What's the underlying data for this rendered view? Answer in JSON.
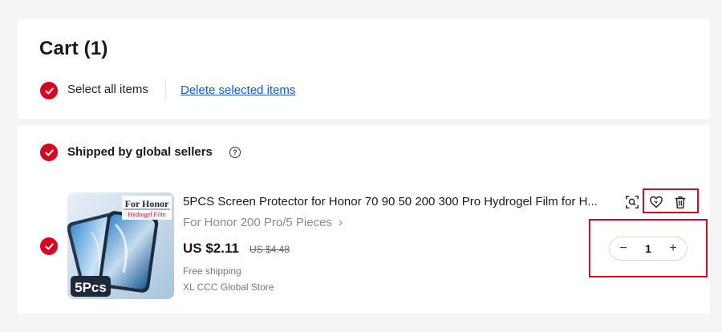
{
  "header": {
    "title": "Cart (1)",
    "select_all_label": "Select all items",
    "delete_label": "Delete selected items"
  },
  "seller_group": {
    "label": "Shipped by global sellers",
    "help_icon": "?"
  },
  "item": {
    "title": "5PCS Screen Protector for Honor 70 90 50 200 300 Pro Hydrogel Film for H...",
    "variant": "For Honor 200 Pro/5 Pieces",
    "variant_chevron": "›",
    "price": "US $2.11",
    "old_price": "US $4.48",
    "shipping": "Free shipping",
    "store": "XL CCC Global Store",
    "quantity": "1",
    "minus": "−",
    "plus": "+",
    "thumb_brand": "For Honor",
    "thumb_sub": "Hydrogel Film",
    "thumb_count": "5Pcs"
  },
  "colors": {
    "accent": "#d9041f",
    "link": "#1a55d6",
    "highlight": "#c8102e"
  }
}
